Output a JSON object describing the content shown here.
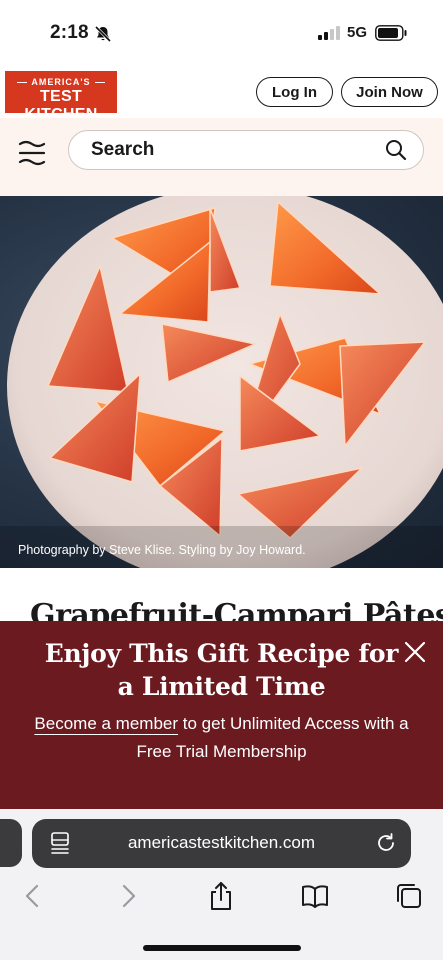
{
  "status_bar": {
    "time": "2:18",
    "network": "5G",
    "icons": [
      "bell-off-icon",
      "signal-icon",
      "battery-icon"
    ]
  },
  "header": {
    "logo_top": "AMERICA'S",
    "logo_bottom": "TEST KITCHEN",
    "login_label": "Log In",
    "join_label": "Join Now",
    "brand_color": "#d5381e"
  },
  "search": {
    "label": "Search",
    "icons": [
      "menu-icon",
      "search-icon"
    ]
  },
  "hero": {
    "caption": "Photography by Steve Klise. Styling by Joy Howard."
  },
  "article": {
    "title": "Grapefruit-Campari Pâtes de Fruits"
  },
  "gift_banner": {
    "title": "Enjoy This Gift Recipe for a Limited Time",
    "link_text": "Become a member",
    "body_rest": " to get Unlimited Access with a Free Trial Membership",
    "background": "#6b1a20"
  },
  "browser": {
    "url": "americastestkitchen.com",
    "toolbar_icons": [
      "back-icon",
      "forward-icon",
      "share-icon",
      "bookmarks-icon",
      "tabs-icon"
    ]
  }
}
